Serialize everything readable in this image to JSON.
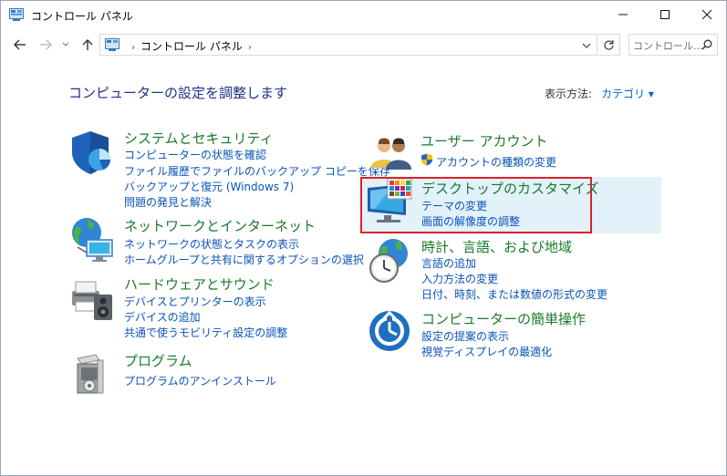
{
  "window": {
    "title": "コントロール パネル",
    "minimize": "—",
    "maximize": "☐",
    "close": "✕"
  },
  "addressbar": {
    "path": [
      "コントロール パネル"
    ],
    "search_placeholder": "コントロール..."
  },
  "main": {
    "heading": "コンピューターの設定を調整します",
    "view_by_label": "表示方法:",
    "view_by_value": "カテゴリ ▾"
  },
  "categories_left": [
    {
      "title": "システムとセキュリティ",
      "links": [
        "コンピューターの状態を確認",
        "ファイル履歴でファイルのバックアップ コピーを保存",
        "バックアップと復元 (Windows 7)",
        "問題の発見と解決"
      ]
    },
    {
      "title": "ネットワークとインターネット",
      "links": [
        "ネットワークの状態とタスクの表示",
        "ホームグループと共有に関するオプションの選択"
      ]
    },
    {
      "title": "ハードウェアとサウンド",
      "links": [
        "デバイスとプリンターの表示",
        "デバイスの追加",
        "共通で使うモビリティ設定の調整"
      ]
    },
    {
      "title": "プログラム",
      "links": [
        "プログラムのアンインストール"
      ]
    }
  ],
  "categories_right": [
    {
      "title": "ユーザー アカウント",
      "links": [
        "アカウントの種類の変更"
      ]
    },
    {
      "title": "デスクトップのカスタマイズ",
      "links": [
        "テーマの変更",
        "画面の解像度の調整"
      ]
    },
    {
      "title": "時計、言語、および地域",
      "links": [
        "言語の追加",
        "入力方法の変更",
        "日付、時刻、または数値の形式の変更"
      ]
    },
    {
      "title": "コンピューターの簡単操作",
      "links": [
        "設定の提案の表示",
        "視覚ディスプレイの最適化"
      ]
    }
  ],
  "colors": {
    "category_title": "#1a7a2c",
    "link": "#0a53b8",
    "heading": "#1e3287",
    "highlight": "#e3f1fb",
    "annotation_box": "#e0202a"
  }
}
